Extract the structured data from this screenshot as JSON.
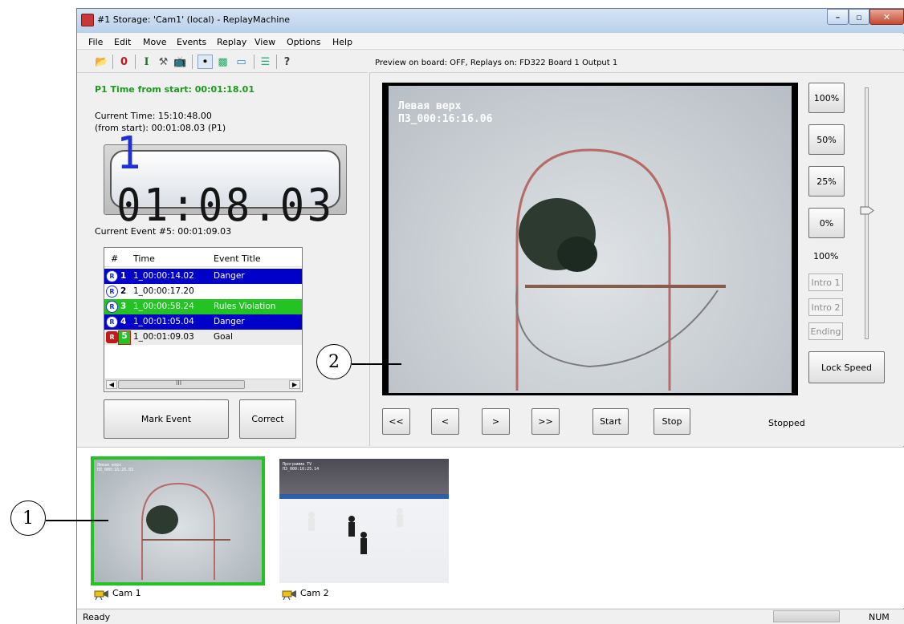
{
  "window": {
    "title": "#1 Storage: 'Cam1' (local) - ReplayMachine"
  },
  "menu": [
    "File",
    "Edit",
    "Move",
    "Events",
    "Replay",
    "View",
    "Options",
    "Help"
  ],
  "preview_info": "Preview on board: OFF, Replays on: FD322 Board 1 Output 1",
  "left": {
    "p1_time": "P1 Time from start: 00:01:18.01",
    "current_time": "Current Time: 15:10:48.00",
    "from_start": "(from start): 00:01:08.03 (P1)",
    "clock_first": "1",
    "clock_rest": "01:08.03",
    "current_event": "Current Event #5: 00:01:09.03"
  },
  "events": {
    "headers": [
      "#",
      "Time",
      "Event Title"
    ],
    "rows": [
      {
        "num": "1",
        "time": "1_00:00:14.02",
        "title": "Danger"
      },
      {
        "num": "2",
        "time": "1_00:00:17.20",
        "title": ""
      },
      {
        "num": "3",
        "time": "1_00:00:58.24",
        "title": "Rules Violation"
      },
      {
        "num": "4",
        "time": "1_00:01:05.04",
        "title": "Danger"
      },
      {
        "num": "5",
        "time": "1_00:01:09.03",
        "title": "Goal"
      }
    ],
    "scroll_mark": "III",
    "row_colors": {
      "danger": "#0000c8",
      "rules": "#22c322",
      "goal": "#ececec",
      "selected_num_bg": "#22c322"
    }
  },
  "buttons": {
    "mark_event": "Mark Event",
    "correct": "Correct",
    "start": "Start",
    "stop": "Stop",
    "lock_speed": "Lock Speed"
  },
  "speed": {
    "p100": "100%",
    "p50": "50%",
    "p25": "25%",
    "p0": "0%",
    "current": "100%"
  },
  "disabled_buttons": {
    "intro1": "Intro 1",
    "intro2": "Intro 2",
    "ending": "Ending"
  },
  "nav": {
    "rew_fast": "<<",
    "rew": "<",
    "fwd": ">",
    "fwd_fast": ">>"
  },
  "playback_status": "Stopped",
  "video": {
    "line1": "Левая верх",
    "line2": "ПЗ_000:16:16.06"
  },
  "thumbs": {
    "cam1": {
      "label": "Cam 1",
      "line1": "Левая верх",
      "line2": "ПЗ_000:16:26.03"
    },
    "cam2": {
      "label": "Cam 2",
      "line1": "Программа TV",
      "line2": "ПЗ_000:16:25.14"
    }
  },
  "statusbar": {
    "text": "Ready",
    "num": "NUM"
  },
  "callouts": {
    "c1": "1",
    "c2": "2"
  }
}
